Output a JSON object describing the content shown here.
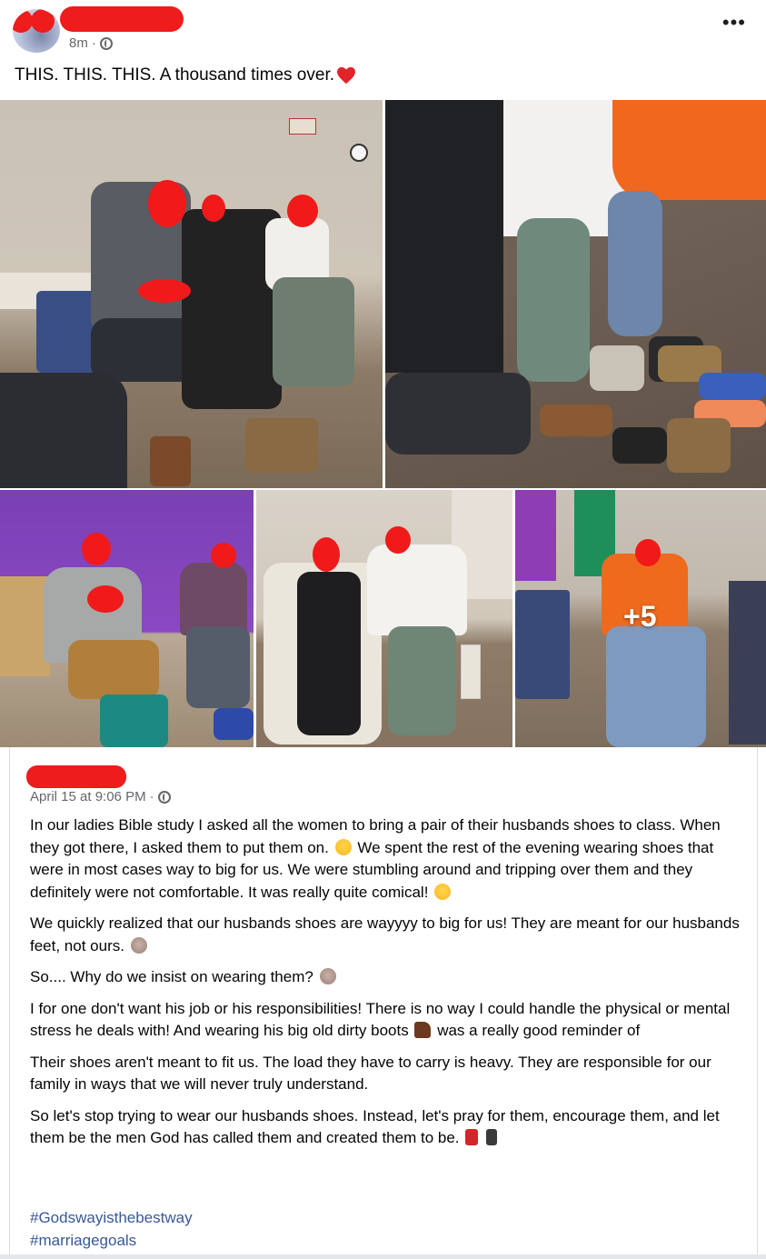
{
  "post": {
    "time": "8m",
    "separator": "·",
    "more_label": "•••",
    "text": "THIS. THIS. THIS. A thousand times over."
  },
  "photos": {
    "more_count": "+5"
  },
  "shared_post": {
    "date": "April 15 at 9:06 PM",
    "separator": "·",
    "paragraphs": {
      "p1a": "In our ladies Bible study I asked all the women to bring a pair of their husbands shoes to class. When they got there, I asked them to put them on.",
      "p1b": "We spent the rest of the evening wearing shoes that were in most cases way to big for us. We were stumbling around and tripping over them and they definitely were not comfortable. It was really quite comical!",
      "p2": "We quickly realized that our husbands shoes are wayyyy to big for us! They are meant for our husbands feet, not ours.",
      "p3": "So.... Why do we insist on wearing them?",
      "p4a": "I for one don't want his job or his responsibilities! There is no way I could handle the physical or mental stress he deals with! And wearing his big old dirty boots",
      "p4b": "was a really good reminder of",
      "p5": "Their shoes aren't meant to fit us. The load they have to carry is heavy. They are responsible for our family in ways that we will never truly understand.",
      "p6": "So let's stop trying to wear our husbands shoes. Instead, let's pray for them, encourage them, and let them be the men God has called them and created them to be."
    },
    "hashtags": [
      "#Godswayisthebestway",
      "#marriagegoals"
    ]
  },
  "colors": {
    "redaction": "#ee1c1c",
    "hashtag": "#385898",
    "meta_gray": "#65676b"
  },
  "icons": [
    "globe-icon",
    "heart-icon",
    "more-icon",
    "smile-emoji",
    "laugh-emoji",
    "facepalm-emoji",
    "boot-emoji",
    "dancer-emoji",
    "man-emoji"
  ]
}
